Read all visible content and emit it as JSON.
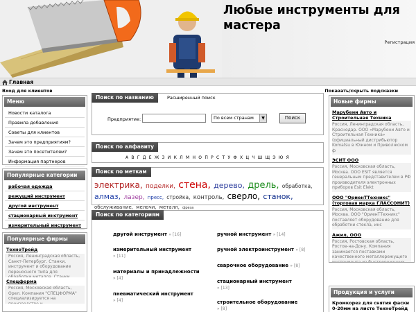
{
  "header": {
    "title": "Любые инструменты для мастера",
    "registration": "Регистрация"
  },
  "breadcrumb": {
    "home": "Главная"
  },
  "client_login": "Вход для клиентов",
  "toggle_hints": "Показать/скрыть подсказки",
  "menu": {
    "title": "Меню",
    "items": [
      "Новости каталога",
      "Правила добавления",
      "Советы для клиентов",
      "Зачем это предприятиям?",
      "Зачем это посетителям?",
      "Информация партнеров"
    ]
  },
  "popular_categories": {
    "title": "Популярные категории",
    "items": [
      "рабочая одежда",
      "режущий инструмент",
      "другой инструмент",
      "стационарный инструмент",
      "измерительный инструмент"
    ]
  },
  "popular_firms": {
    "title": "Популярные фирмы",
    "items": [
      {
        "name": "ТехноТрейд",
        "desc": "Россия, Ленинградская область, Санкт-Петербург. Станки, инструмент и оборудование переносного типа для обработки металла. Станки ручные и автоматиче"
      },
      {
        "name": "Спецформа",
        "desc": "Россия, Московская область, Орел. Компания \"СПЕЦФОРМА\" специализируется на производстве и"
      }
    ]
  },
  "search_by_name": {
    "tab": "Поиск по названию",
    "advanced": "Расширенный поиск",
    "label": "Предприятие:",
    "input_value": "",
    "country": "По всем странам",
    "button": "Поиск"
  },
  "search_by_alphabet": {
    "tab": "Поиск по алфавиту",
    "letters": "А В Г Д Е Ж З И К Л М Н О П Р С Т У Ф Х Ц Ч Ш Щ Э Ю Я"
  },
  "search_by_tags": {
    "tab": "Поиск по меткам",
    "tags": [
      {
        "text": "электрика,",
        "color": "#b22222"
      },
      {
        "text": "поделки,",
        "color": "#b22222"
      },
      {
        "text": "стена,",
        "color": "#cc0000"
      },
      {
        "text": "дерево,",
        "color": "#2e3f9e"
      },
      {
        "text": "дрель,",
        "color": "#1c8c1c"
      },
      {
        "text": "обработка,",
        "color": "#333333"
      },
      {
        "text": "алмаз,",
        "color": "#1f3fa8"
      },
      {
        "text": "лазер,",
        "color": "#a040a0"
      },
      {
        "text": "пресс,",
        "color": "#1f3fa8"
      },
      {
        "text": "стройка,",
        "color": "#333333"
      },
      {
        "text": "контроль,",
        "color": "#333333"
      },
      {
        "text": "сверло,",
        "color": "#000000"
      },
      {
        "text": "станок,",
        "color": "#0b2a8a"
      },
      {
        "text": "обслуживание,",
        "color": "#333333"
      },
      {
        "text": "мелочи,",
        "color": "#333333"
      },
      {
        "text": "металл,",
        "color": "#333333"
      },
      {
        "text": "фреза",
        "color": "#333333"
      }
    ]
  },
  "search_by_categories": {
    "tab": "Поиск по категориям",
    "items": [
      {
        "name": "другой инструмент",
        "count": "» [16]"
      },
      {
        "name": "ручной инструмент",
        "count": "» [14]"
      },
      {
        "name": "измерительный инструмент",
        "count": "» [11]"
      },
      {
        "name": "ручной электроинструмент",
        "count": "» [8]"
      },
      {
        "name": "материалы и принадлежности",
        "count": "» [4]"
      },
      {
        "name": "сварочное оборудование",
        "count": "» [8]"
      },
      {
        "name": "пневматический инструмент",
        "count": "» [4]"
      },
      {
        "name": "стационарный инструмент",
        "count": "» [13]"
      },
      {
        "name": "строительное оборудование",
        "count": "» [8]"
      }
    ]
  },
  "new_firms": {
    "title": "Новые фирмы",
    "items": [
      {
        "name": "Марубени Авто и Строительная Техника",
        "desc": "Россия, Ленинградская область, Краснодар. ООО «Марубени Авто и Строительная Техника» (официальный дистрибьютор Komatsu в Южном и Приволжском ф"
      },
      {
        "name": "ЭСИТ ООО",
        "desc": "Россия, Московская область, Москва. ООО ESIT является генеральным представителем в РФ производителя электронных приборов Esit Elekt"
      },
      {
        "name": "ООО \"ОриенТТехникс\" (торговая марка ГЛАССОНИТ)",
        "desc": "Россия, Московская область, Москва. ООО \"ОриенТТехникс\" поставляет оборудование для обработки стекла, инс"
      },
      {
        "name": "Ажил, ООО",
        "desc": "Россия, Ростовская область, Ростов-на-Дону. Компания занимается поставками качественного металлорежущего инструмента из быстрорежущих сталей."
      }
    ]
  },
  "products": {
    "title": "Продукция и услуги",
    "first": "Кромкорез для снятия фаски 0-20мм на листе ТехноТрейд"
  }
}
